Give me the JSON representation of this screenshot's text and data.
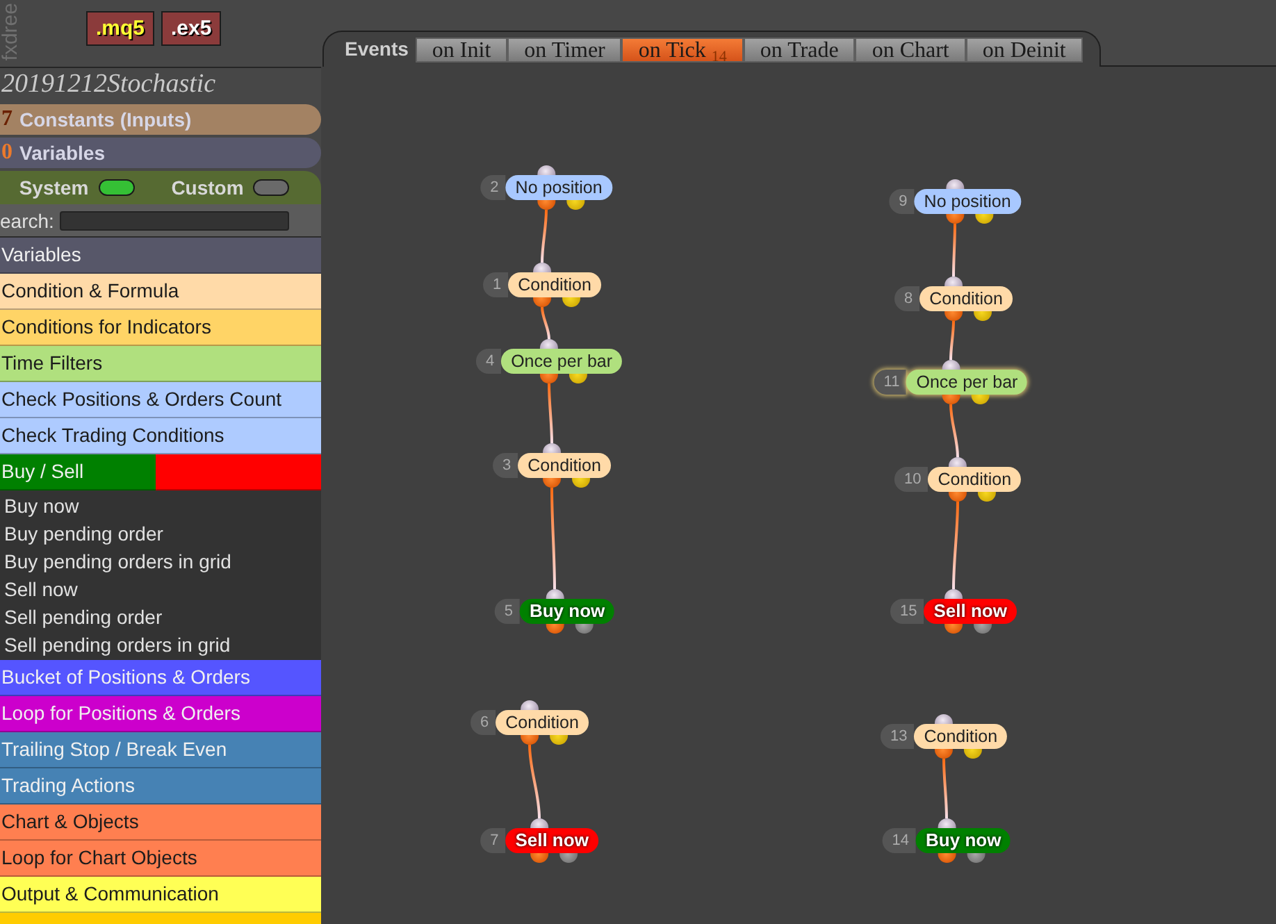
{
  "sidebar_header": {
    "logo": "fxdree",
    "buttons": [
      {
        "label": ".mq5",
        "kind": "source"
      },
      {
        "label": ".ex5",
        "kind": "compiled"
      }
    ]
  },
  "project": {
    "title": "20191212Stochastic"
  },
  "sections": [
    {
      "count": "7",
      "label": "Constants (Inputs)",
      "color": "#a38263"
    },
    {
      "count": "0",
      "label": "Variables",
      "color": "#58586c"
    }
  ],
  "toggles": [
    {
      "label": "System",
      "on": true
    },
    {
      "label": "Custom",
      "on": false
    }
  ],
  "search": {
    "label": "earch:"
  },
  "categories": [
    {
      "label": "Variables",
      "color": "#575769"
    },
    {
      "label": "Condition & Formula",
      "color": "#ffdaa8"
    },
    {
      "label": "Conditions for Indicators",
      "color": "#ffd466"
    },
    {
      "label": "Time Filters",
      "color": "#b0e07e"
    },
    {
      "label": "Check Positions & Orders Count",
      "color": "#aecbff"
    },
    {
      "label": "Check Trading Conditions",
      "color": "#aecbff"
    },
    {
      "label": "Buy / Sell",
      "color": "#008000",
      "secondary": {
        "color": "#ff0000"
      },
      "children": [
        {
          "label": "Buy now"
        },
        {
          "label": "Buy pending order"
        },
        {
          "label": "Buy pending orders in grid"
        },
        {
          "label": "Sell now"
        },
        {
          "label": "Sell pending order"
        },
        {
          "label": "Sell pending orders in grid"
        }
      ]
    },
    {
      "label": "Bucket of Positions & Orders",
      "color": "#5555ff"
    },
    {
      "label": "Loop for Positions & Orders",
      "color": "#cc00cc"
    },
    {
      "label": "Trailing Stop / Break Even",
      "color": "#4682b4"
    },
    {
      "label": "Trading Actions",
      "color": "#4682b4"
    },
    {
      "label": "Chart & Objects",
      "color": "#ff7f50"
    },
    {
      "label": "Loop for Chart Objects",
      "color": "#ff7f50"
    },
    {
      "label": "Output & Communication",
      "color": "#ffff55"
    },
    {
      "color": "#ffcc00"
    }
  ],
  "events": {
    "label": "Events",
    "tabs": [
      {
        "label": "on Init",
        "selected": false
      },
      {
        "label": "on Timer",
        "selected": false
      },
      {
        "label": "on Tick",
        "count": "14",
        "selected": true
      },
      {
        "label": "on Trade",
        "selected": false
      },
      {
        "label": "on Chart",
        "selected": false
      },
      {
        "label": "on Deinit",
        "selected": false
      }
    ]
  },
  "canvas": {
    "flows": [
      {
        "blocks": [
          {
            "number": "2",
            "label": "No position",
            "kind": "condition",
            "color": "#a8c8ff",
            "selected": false
          },
          {
            "number": "1",
            "label": "Condition",
            "kind": "condition",
            "color": "#ffdaa8",
            "selected": false
          },
          {
            "number": "4",
            "label": "Once per bar",
            "kind": "condition",
            "color": "#b0e07e",
            "selected": false
          },
          {
            "number": "3",
            "label": "Condition",
            "kind": "condition",
            "color": "#ffdaa8",
            "selected": false
          },
          {
            "number": "5",
            "label": "Buy now",
            "kind": "order",
            "color": "#008000",
            "selected": false
          }
        ]
      },
      {
        "blocks": [
          {
            "number": "6",
            "label": "Condition",
            "kind": "condition",
            "color": "#ffdaa8",
            "selected": false
          },
          {
            "number": "7",
            "label": "Sell now",
            "kind": "order",
            "color": "#ff0000",
            "selected": false
          }
        ]
      },
      {
        "blocks": [
          {
            "number": "9",
            "label": "No position",
            "kind": "condition",
            "color": "#a8c8ff",
            "selected": false
          },
          {
            "number": "8",
            "label": "Condition",
            "kind": "condition",
            "color": "#ffdaa8",
            "selected": false
          },
          {
            "number": "11",
            "label": "Once per bar",
            "kind": "condition",
            "color": "#b0e07e",
            "selected": true
          },
          {
            "number": "10",
            "label": "Condition",
            "kind": "condition",
            "color": "#ffdaa8",
            "selected": false
          },
          {
            "number": "15",
            "label": "Sell now",
            "kind": "order",
            "color": "#ff0000",
            "selected": false
          }
        ]
      },
      {
        "blocks": [
          {
            "number": "13",
            "label": "Condition",
            "kind": "condition",
            "color": "#ffdaa8",
            "selected": false
          },
          {
            "number": "14",
            "label": "Buy now",
            "kind": "order",
            "color": "#008000",
            "selected": false
          }
        ]
      }
    ]
  }
}
